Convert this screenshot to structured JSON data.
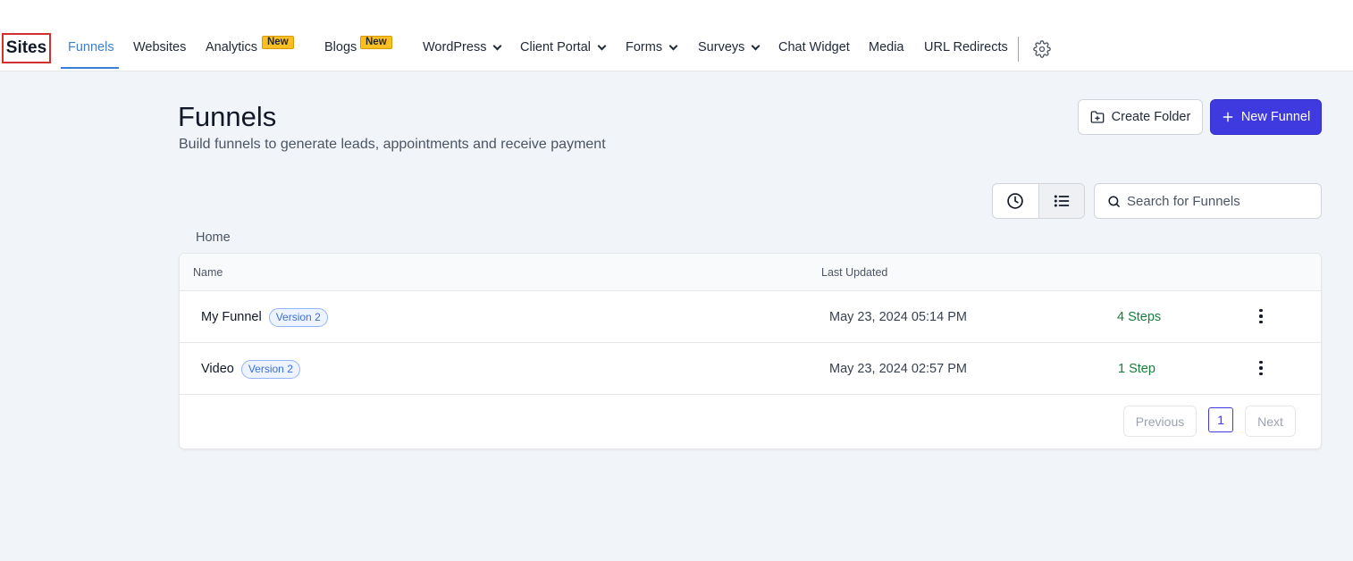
{
  "nav": {
    "site_title": "Sites",
    "items": [
      {
        "label": "Funnels"
      },
      {
        "label": "Websites"
      },
      {
        "label": "Analytics",
        "badge": "New"
      },
      {
        "label": "Blogs",
        "badge": "New"
      },
      {
        "label": "WordPress"
      },
      {
        "label": "Client Portal"
      },
      {
        "label": "Forms"
      },
      {
        "label": "Surveys"
      },
      {
        "label": "Chat Widget"
      },
      {
        "label": "Media"
      },
      {
        "label": "URL Redirects"
      }
    ],
    "active_item": "Funnels",
    "settings_icon": "gear-icon",
    "colors": {
      "active": "#3b7fd8",
      "badge": "#fbbf24",
      "title_border": "#d32f2f"
    }
  },
  "header": {
    "title": "Funnels",
    "subtitle": "Build funnels to generate leads, appointments and receive payment",
    "create_folder_label": "Create Folder",
    "new_funnel_label": "New Funnel",
    "primary_color": "#3e3ae0"
  },
  "toolbar": {
    "search_placeholder": "Search for Funnels",
    "view_modes": [
      "clock-icon",
      "list-icon"
    ],
    "active_view": "list"
  },
  "breadcrumb": "Home",
  "table": {
    "columns": [
      "Name",
      "Last Updated"
    ],
    "rows": [
      {
        "name": "My Funnel",
        "version": "Version 2",
        "updated": "May 23, 2024 05:14 PM",
        "steps": "4 Steps"
      },
      {
        "name": "Video",
        "version": "Version 2",
        "updated": "May 23, 2024 02:57 PM",
        "steps": "1 Step"
      }
    ]
  },
  "pagination": {
    "previous_label": "Previous",
    "current_page": "1",
    "next_label": "Next"
  }
}
